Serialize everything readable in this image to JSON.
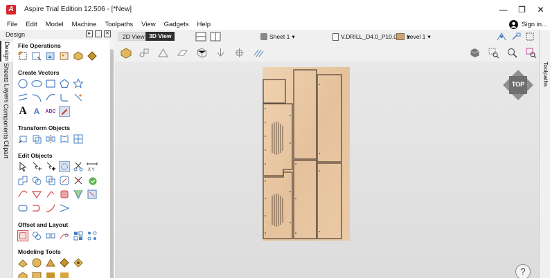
{
  "window": {
    "title": "Aspire Trial Edition 12.506 - [*New]",
    "logo_letter": "A",
    "minimize": "—",
    "restore": "❐",
    "close": "✕"
  },
  "menu": {
    "items": [
      "File",
      "Edit",
      "Model",
      "Machine",
      "Toolpaths",
      "View",
      "Gadgets",
      "Help"
    ],
    "sign_in": "Sign in..."
  },
  "left_panel": {
    "header": "Design",
    "tabs": [
      "Design",
      "Sheets",
      "Layers",
      "Components",
      "Clipart"
    ],
    "sections": [
      {
        "title": "File Operations"
      },
      {
        "title": "Create Vectors"
      },
      {
        "title": "Transform Objects"
      },
      {
        "title": "Edit Objects"
      },
      {
        "title": "Offset and Layout"
      },
      {
        "title": "Modeling Tools"
      }
    ],
    "text_tool_glyph": "A",
    "text_tool_glyph2": "A",
    "text_tool_glyph3": "ABC"
  },
  "viewbar": {
    "tab_2d": "2D View",
    "tab_3d": "3D View",
    "sheet_label": "Sheet 1",
    "toolpath_label": "V.DRILL_D4.0_P10.0_...",
    "level_label": "Level 1",
    "dropdown_glyph": "▾"
  },
  "right_panel": {
    "tab": "Toolpaths"
  },
  "viewport": {
    "cube_label": "TOP",
    "help_label": "?",
    "colors": {
      "wood": "#e9c9a6",
      "outline": "#5a4a3c"
    }
  }
}
